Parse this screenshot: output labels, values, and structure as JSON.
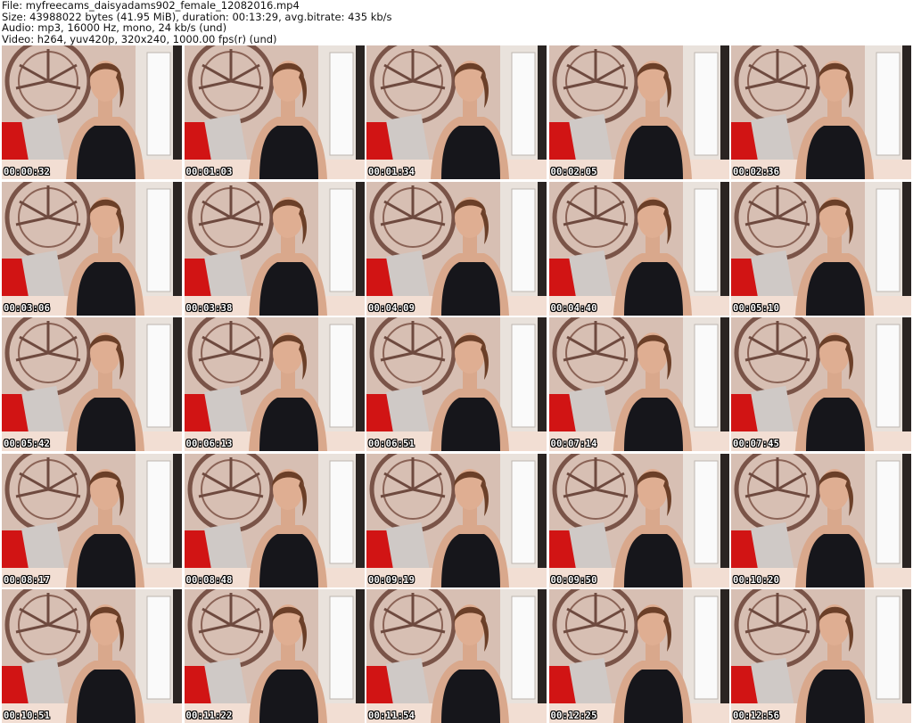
{
  "meta": {
    "file_line": "File: myfreecams_daisyadams902_female_12082016.mp4",
    "size_line": "Size: 43988022 bytes (41.95 MiB), duration: 00:13:29, avg.bitrate: 435 kb/s",
    "audio_line": "Audio: mp3, 16000 Hz, mono, 24 kb/s (und)",
    "video_line": "Video: h264, yuv420p, 320x240, 1000.00 fps(r) (und)"
  },
  "thumbnails": [
    {
      "timestamp": "00:00:32"
    },
    {
      "timestamp": "00:01:03"
    },
    {
      "timestamp": "00:01:34"
    },
    {
      "timestamp": "00:02:05"
    },
    {
      "timestamp": "00:02:36"
    },
    {
      "timestamp": "00:03:06"
    },
    {
      "timestamp": "00:03:38"
    },
    {
      "timestamp": "00:04:09"
    },
    {
      "timestamp": "00:04:40"
    },
    {
      "timestamp": "00:05:10"
    },
    {
      "timestamp": "00:05:42"
    },
    {
      "timestamp": "00:06:13"
    },
    {
      "timestamp": "00:06:51"
    },
    {
      "timestamp": "00:07:14"
    },
    {
      "timestamp": "00:07:45"
    },
    {
      "timestamp": "00:08:17"
    },
    {
      "timestamp": "00:08:48"
    },
    {
      "timestamp": "00:09:19"
    },
    {
      "timestamp": "00:09:50"
    },
    {
      "timestamp": "00:10:20"
    },
    {
      "timestamp": "00:10:51"
    },
    {
      "timestamp": "00:11:22"
    },
    {
      "timestamp": "00:11:54"
    },
    {
      "timestamp": "00:12:25"
    },
    {
      "timestamp": "00:12:56"
    }
  ]
}
